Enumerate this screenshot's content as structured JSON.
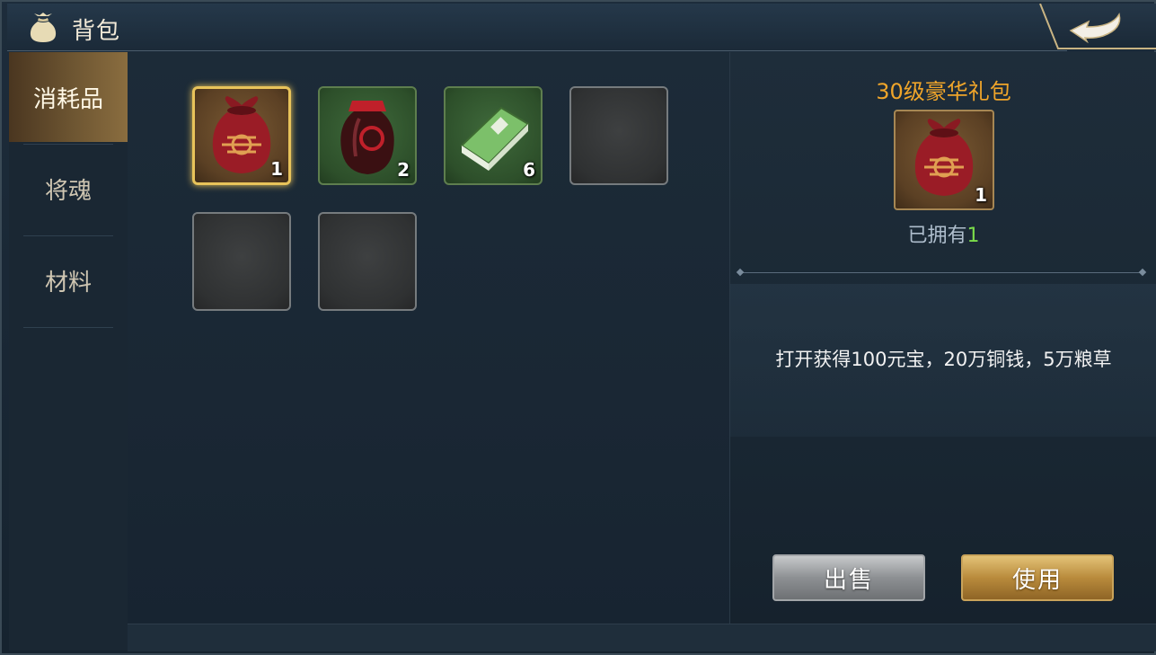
{
  "header": {
    "title": "背包",
    "icon": "bag-icon",
    "back_icon": "back-arrow-icon"
  },
  "tabs": [
    {
      "label": "消耗品",
      "active": true
    },
    {
      "label": "将魂",
      "active": false
    },
    {
      "label": "材料",
      "active": false
    }
  ],
  "inventory": {
    "slots": [
      {
        "item": "gift-bag-icon",
        "count": "1",
        "frame": "gold",
        "selected": true
      },
      {
        "item": "wine-jar-icon",
        "count": "2",
        "frame": "green",
        "selected": false
      },
      {
        "item": "book-icon",
        "count": "6",
        "frame": "green",
        "selected": false
      },
      {
        "item": null,
        "count": "",
        "frame": "empty",
        "selected": false
      },
      {
        "item": null,
        "count": "",
        "frame": "empty",
        "selected": false
      },
      {
        "item": null,
        "count": "",
        "frame": "empty",
        "selected": false
      }
    ]
  },
  "detail": {
    "name": "30级豪华礼包",
    "count": "1",
    "owned_label": "已拥有",
    "owned_count": "1",
    "description": "打开获得100元宝，20万铜钱，5万粮草",
    "sell_label": "出售",
    "use_label": "使用"
  },
  "colors": {
    "item_name": "#f0a52a",
    "owned_count": "#7bdc4a",
    "active_tab": "#6e5632"
  }
}
